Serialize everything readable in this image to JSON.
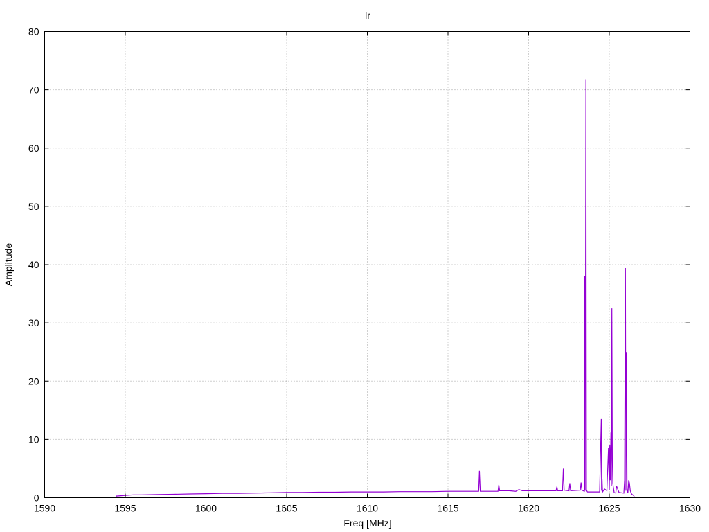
{
  "chart_data": {
    "type": "line",
    "title": "lr",
    "xlabel": "Freq [MHz]",
    "ylabel": "Amplitude",
    "xlim": [
      1590,
      1630
    ],
    "ylim": [
      0,
      80
    ],
    "x_ticks": [
      1590,
      1595,
      1600,
      1605,
      1610,
      1615,
      1620,
      1625,
      1630
    ],
    "y_ticks": [
      0,
      10,
      20,
      30,
      40,
      50,
      60,
      70,
      80
    ],
    "x_tick_labels": [
      "1590",
      "1595",
      "1600",
      "1605",
      "1610",
      "1615",
      "1620",
      "1625",
      "1630"
    ],
    "y_tick_labels": [
      "0",
      "10",
      "20",
      "30",
      "40",
      "50",
      "60",
      "70",
      "80"
    ],
    "grid": true,
    "legend": "none",
    "series": [
      {
        "color": "#9400d3",
        "x": [
          1594.4,
          1594.45,
          1594.5,
          1595.0,
          1595.5,
          1596.0,
          1597.0,
          1598.0,
          1599.0,
          1600.0,
          1601.0,
          1602.0,
          1603.0,
          1604.0,
          1605.0,
          1606.0,
          1607.0,
          1608.0,
          1609.0,
          1610.0,
          1611.0,
          1612.0,
          1613.0,
          1614.0,
          1615.0,
          1616.0,
          1616.9,
          1616.95,
          1617.0,
          1617.5,
          1618.1,
          1618.15,
          1618.2,
          1618.8,
          1619.2,
          1619.4,
          1619.6,
          1620.0,
          1620.5,
          1621.0,
          1621.7,
          1621.75,
          1621.8,
          1622.1,
          1622.15,
          1622.2,
          1622.5,
          1622.55,
          1622.6,
          1623.2,
          1623.25,
          1623.3,
          1623.45,
          1623.48,
          1623.5,
          1623.55,
          1623.58,
          1623.62,
          1623.65,
          1624.0,
          1624.4,
          1624.5,
          1624.52,
          1624.55,
          1624.58,
          1624.7,
          1624.85,
          1624.95,
          1625.0,
          1625.03,
          1625.06,
          1625.1,
          1625.13,
          1625.16,
          1625.19,
          1625.22,
          1625.25,
          1625.3,
          1625.4,
          1625.45,
          1625.6,
          1625.9,
          1625.95,
          1626.0,
          1626.03,
          1626.06,
          1626.1,
          1626.15,
          1626.2,
          1626.25,
          1626.3,
          1626.35,
          1626.4,
          1626.5,
          1626.55
        ],
        "values": [
          0.0,
          0.3,
          0.3,
          0.4,
          0.5,
          0.5,
          0.55,
          0.6,
          0.65,
          0.7,
          0.75,
          0.75,
          0.8,
          0.85,
          0.9,
          0.9,
          0.95,
          0.95,
          1.0,
          1.0,
          1.0,
          1.05,
          1.05,
          1.05,
          1.1,
          1.1,
          1.1,
          4.6,
          1.1,
          1.1,
          1.1,
          2.2,
          1.2,
          1.2,
          1.1,
          1.4,
          1.2,
          1.2,
          1.2,
          1.2,
          1.2,
          1.9,
          1.2,
          1.2,
          5.0,
          1.3,
          1.2,
          2.5,
          1.2,
          1.3,
          2.6,
          1.3,
          1.1,
          38.0,
          1.2,
          71.8,
          1.4,
          1.1,
          1.0,
          1.0,
          1.0,
          13.5,
          1.2,
          3.2,
          1.0,
          1.5,
          1.2,
          8.5,
          1.3,
          9.0,
          3.0,
          11.2,
          2.0,
          32.5,
          6.6,
          2.5,
          1.8,
          0.9,
          0.8,
          2.0,
          0.9,
          0.8,
          3.0,
          39.4,
          1.2,
          25.0,
          1.5,
          0.8,
          3.0,
          2.5,
          1.2,
          0.8,
          0.6,
          0.4,
          0.2
        ]
      }
    ]
  }
}
